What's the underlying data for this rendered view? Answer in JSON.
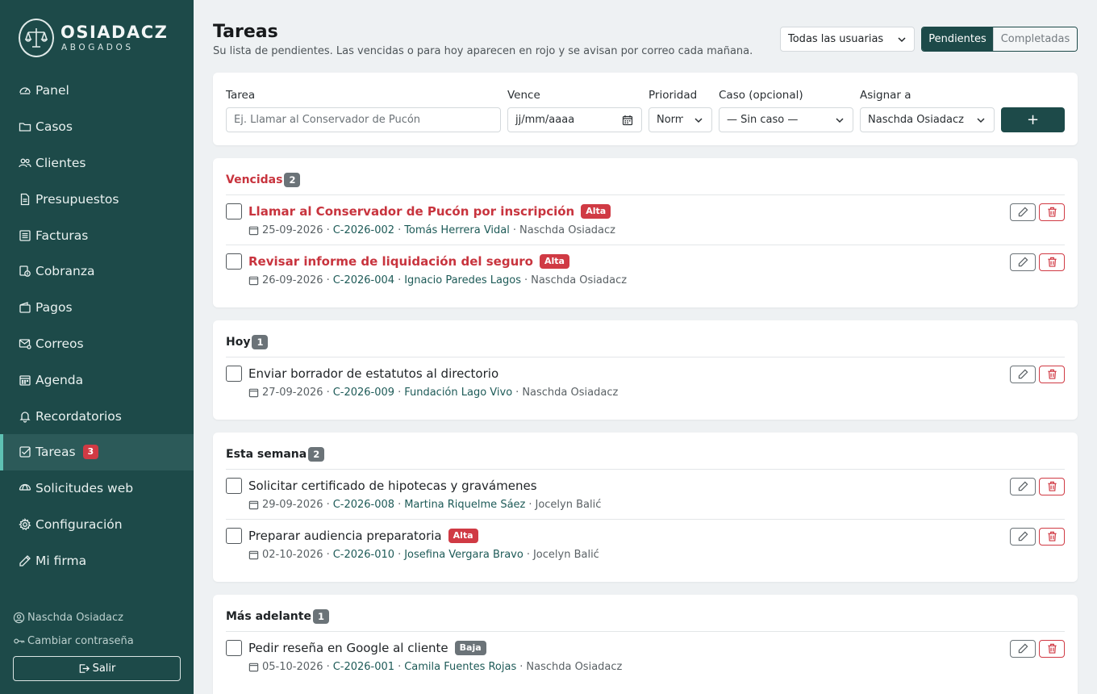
{
  "brand": {
    "name": "OSIADACZ",
    "subtitle": "ABOGADOS"
  },
  "sidebar": {
    "items": [
      {
        "label": "Panel",
        "icon": "dashboard-icon"
      },
      {
        "label": "Casos",
        "icon": "folder-icon"
      },
      {
        "label": "Clientes",
        "icon": "users-icon"
      },
      {
        "label": "Presupuestos",
        "icon": "document-icon"
      },
      {
        "label": "Facturas",
        "icon": "invoice-icon"
      },
      {
        "label": "Cobranza",
        "icon": "collection-icon"
      },
      {
        "label": "Pagos",
        "icon": "wallet-icon"
      },
      {
        "label": "Correos",
        "icon": "mail-icon"
      },
      {
        "label": "Agenda",
        "icon": "calendar-icon"
      },
      {
        "label": "Recordatorios",
        "icon": "bell-icon"
      },
      {
        "label": "Tareas",
        "icon": "checkbox-icon",
        "badge": "3",
        "active": true
      },
      {
        "label": "Solicitudes web",
        "icon": "web-icon"
      },
      {
        "label": "Configuración",
        "icon": "gear-icon"
      },
      {
        "label": "Mi firma",
        "icon": "pen-icon"
      }
    ],
    "user_name": "Naschda Osiadacz",
    "change_password": "Cambiar contraseña",
    "logout": "Salir"
  },
  "header": {
    "title": "Tareas",
    "subtitle": "Su lista de pendientes. Las vencidas o para hoy aparecen en rojo y se avisan por correo cada mañana.",
    "user_filter": "Todas las usuarias",
    "tabs": [
      "Pendientes",
      "Completadas"
    ]
  },
  "form": {
    "task_label": "Tarea",
    "task_placeholder": "Ej. Llamar al Conservador de Pucón",
    "due_label": "Vence",
    "due_placeholder": "jj/mm/aaaa",
    "priority_label": "Prioridad",
    "priority_value": "Normal",
    "case_label": "Caso (opcional)",
    "case_value": "— Sin caso —",
    "assign_label": "Asignar a",
    "assign_value": "Naschda Osiadacz",
    "add_label": "+"
  },
  "sections": [
    {
      "title": "Vencidas",
      "count": "2",
      "overdue": true,
      "tasks": [
        {
          "title": "Llamar al Conservador de Pucón por inscripción",
          "priority": "Alta",
          "date": "25-09-2026",
          "case": "C-2026-002",
          "client": "Tomás Herrera Vidal",
          "assignee": "Naschda Osiadacz"
        },
        {
          "title": "Revisar informe de liquidación del seguro",
          "priority": "Alta",
          "date": "26-09-2026",
          "case": "C-2026-004",
          "client": "Ignacio Paredes Lagos",
          "assignee": "Naschda Osiadacz"
        }
      ]
    },
    {
      "title": "Hoy",
      "count": "1",
      "overdue": false,
      "tasks": [
        {
          "title": "Enviar borrador de estatutos al directorio",
          "priority": "",
          "date": "27-09-2026",
          "case": "C-2026-009",
          "client": "Fundación Lago Vivo",
          "assignee": "Naschda Osiadacz"
        }
      ]
    },
    {
      "title": "Esta semana",
      "count": "2",
      "overdue": false,
      "tasks": [
        {
          "title": "Solicitar certificado de hipotecas y gravámenes",
          "priority": "",
          "date": "29-09-2026",
          "case": "C-2026-008",
          "client": "Martina Riquelme Sáez",
          "assignee": "Jocelyn Balić"
        },
        {
          "title": "Preparar audiencia preparatoria",
          "priority": "Alta",
          "date": "02-10-2026",
          "case": "C-2026-010",
          "client": "Josefina Vergara Bravo",
          "assignee": "Jocelyn Balić"
        }
      ]
    },
    {
      "title": "Más adelante",
      "count": "1",
      "overdue": false,
      "tasks": [
        {
          "title": "Pedir reseña en Google al cliente",
          "priority": "Baja",
          "date": "05-10-2026",
          "case": "C-2026-001",
          "client": "Camila Fuentes Rojas",
          "assignee": "Naschda Osiadacz"
        }
      ]
    }
  ],
  "colors": {
    "sidebar": "#1d4a49",
    "accent": "#5ec1b3",
    "danger": "#d03a44",
    "link": "#1d5a57"
  }
}
